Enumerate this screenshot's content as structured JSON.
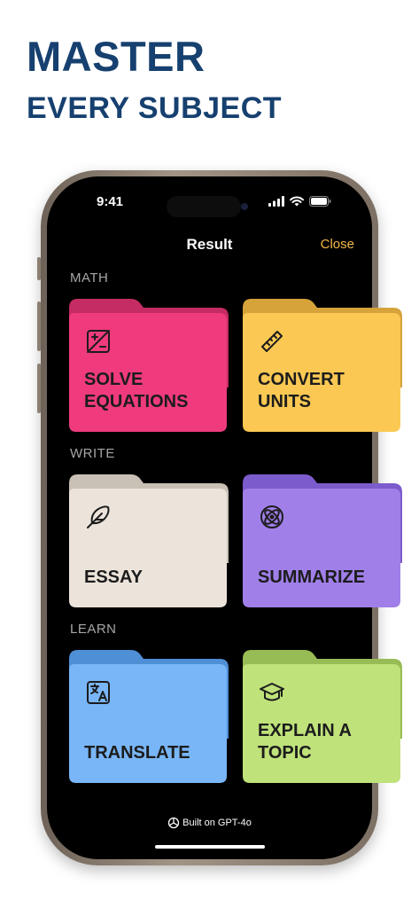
{
  "headline": {
    "line1": "MASTER",
    "line2": "EVERY SUBJECT"
  },
  "status": {
    "time": "9:41"
  },
  "nav": {
    "title": "Result",
    "close": "Close"
  },
  "sections": [
    {
      "label": "MATH",
      "cards": [
        {
          "label": "SOLVE EQUATIONS",
          "icon": "calculator-icon",
          "color": "#ef3b7d",
          "back": "#c42c63"
        },
        {
          "label": "CONVERT UNITS",
          "icon": "ruler-icon",
          "color": "#fbc953",
          "back": "#d5a33a"
        }
      ]
    },
    {
      "label": "WRITE",
      "cards": [
        {
          "label": "ESSAY",
          "icon": "feather-icon",
          "color": "#ece4da",
          "back": "#c9c1b6"
        },
        {
          "label": "SUMMARIZE",
          "icon": "atom-icon",
          "color": "#a07fe9",
          "back": "#7c5ccc"
        }
      ]
    },
    {
      "label": "LEARN",
      "cards": [
        {
          "label": "TRANSLATE",
          "icon": "translate-icon",
          "color": "#79b6f7",
          "back": "#4f8fd6"
        },
        {
          "label": "EXPLAIN A TOPIC",
          "icon": "graduation-cap-icon",
          "color": "#bfe27a",
          "back": "#98bc55"
        }
      ]
    }
  ],
  "footer": {
    "built_on": "Built on GPT-4o"
  }
}
